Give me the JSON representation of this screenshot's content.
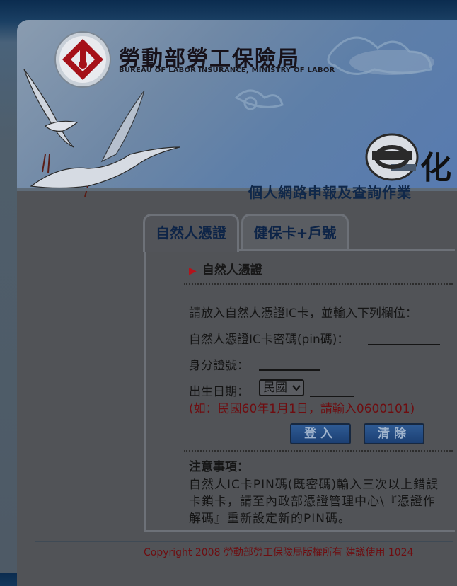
{
  "header": {
    "title_zh": "勞動部勞工保險局",
    "title_en": "BUREAU OF LABOR INSURANCE, MINISTRY OF LABOR",
    "e_logo_text": "化"
  },
  "page_heading": "個人網路申報及查詢作業",
  "tabs": [
    {
      "label": "自然人憑證",
      "active": true
    },
    {
      "label": "健保卡+戶號",
      "active": false
    }
  ],
  "form": {
    "section_title": "自然人憑證",
    "instruction": "請放入自然人憑證IC卡，並輸入下列欄位：",
    "pin_label": "自然人憑證IC卡密碼(pin碼)：",
    "pin_value": "",
    "id_label": "身分證號：",
    "id_value": "",
    "birth_label": "出生日期：",
    "era_selected": "民國",
    "birth_value": "",
    "hint": "(如：民國60年1月1日，請輸入0600101)",
    "login_label": "登入",
    "clear_label": "清除"
  },
  "notice": {
    "title": "注意事項：",
    "lines": [
      "自然人IC卡PIN碼(既密碼)輸入三次以上錯誤",
      "卡鎖卡，請至內政部憑證管理中心\\『憑證作",
      "解碼』重新設定新的PIN碼。"
    ]
  },
  "footer": {
    "copyright": "Copyright 2008 勞動部勞工保險局版權所有 建議使用 1024"
  },
  "colors": {
    "heading": "#10284a",
    "hint_red": "#6e0d10",
    "button_blue": "#2f5b94",
    "triangle_red": "#b4131b"
  }
}
